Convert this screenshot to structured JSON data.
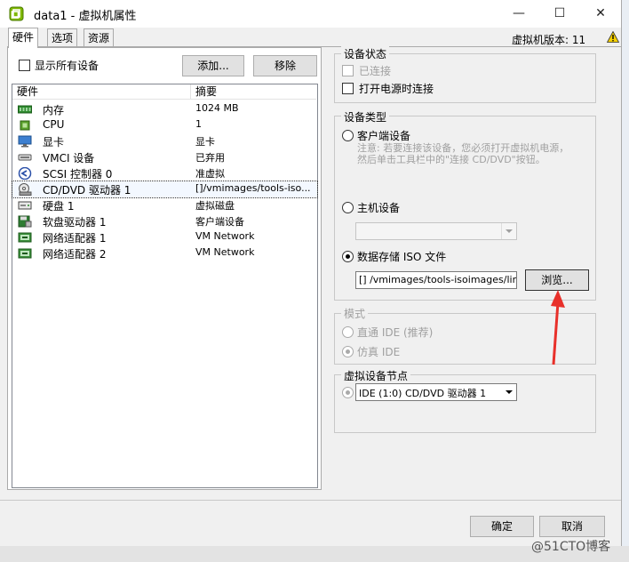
{
  "window": {
    "title": "data1 - 虚拟机属性",
    "minimize": "—",
    "maximize": "☐",
    "close": "✕"
  },
  "tabs": [
    {
      "label": "硬件"
    },
    {
      "label": "选项"
    },
    {
      "label": "资源"
    }
  ],
  "vm_version": "虚拟机版本: 11",
  "left": {
    "show_all_label": "显示所有设备",
    "add_button": "添加...",
    "remove_button": "移除",
    "columns": {
      "hardware": "硬件",
      "summary": "摘要"
    },
    "rows": [
      {
        "name": "内存",
        "summary": "1024 MB",
        "icon": "memory-icon"
      },
      {
        "name": "CPU",
        "summary": "1",
        "icon": "cpu-icon"
      },
      {
        "name": "显卡",
        "summary": "显卡",
        "icon": "display-icon"
      },
      {
        "name": "VMCI 设备",
        "summary": "已弃用",
        "icon": "vmci-icon"
      },
      {
        "name": "SCSI 控制器 0",
        "summary": "准虚拟",
        "icon": "scsi-icon"
      },
      {
        "name": "CD/DVD 驱动器 1",
        "summary": "[]/vmimages/tools-iso...",
        "icon": "cdrom-icon"
      },
      {
        "name": "硬盘 1",
        "summary": "虚拟磁盘",
        "icon": "disk-icon"
      },
      {
        "name": "软盘驱动器 1",
        "summary": "客户端设备",
        "icon": "floppy-icon"
      },
      {
        "name": "网络适配器 1",
        "summary": "VM Network",
        "icon": "nic-icon"
      },
      {
        "name": "网络适配器 2",
        "summary": "VM Network",
        "icon": "nic-icon"
      }
    ]
  },
  "device_status": {
    "label": "设备状态",
    "connected": "已连接",
    "connect_at_power_on": "打开电源时连接"
  },
  "device_type": {
    "label": "设备类型",
    "client_device": "客户端设备",
    "client_note": "注意: 若要连接该设备，您必须打开虚拟机电源，然后单击工具栏中的\"连接 CD/DVD\"按钮。",
    "host_device": "主机设备",
    "datastore_iso": "数据存储 ISO 文件",
    "iso_path": "[] /vmimages/tools-isoimages/linux.iso",
    "browse_button": "浏览..."
  },
  "mode": {
    "label": "模式",
    "passthrough": "直通 IDE (推荐)",
    "emulate": "仿真 IDE"
  },
  "node": {
    "label": "虚拟设备节点",
    "value": "IDE (1:0) CD/DVD 驱动器 1"
  },
  "footer": {
    "ok": "确定",
    "cancel": "取消"
  },
  "watermark": "@51CTO博客",
  "colors": {
    "arrow": "#e8302a",
    "selection": "#f3f8ff"
  }
}
